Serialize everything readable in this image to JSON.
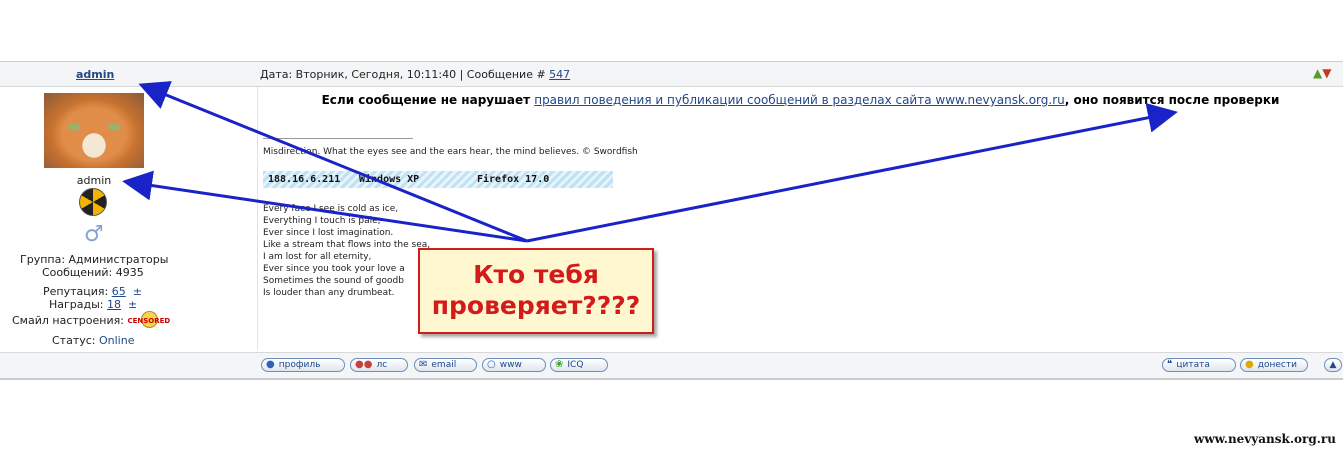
{
  "header": {
    "author": "admin",
    "date_prefix": "Дата: Вторник, Сегодня, 10:11:40 | Сообщение # ",
    "post_number": "547",
    "vote_up_icon": "thumbs-up-icon",
    "vote_down_icon": "thumbs-down-icon"
  },
  "profile": {
    "username": "admin",
    "group": "Группа: Администраторы",
    "messages": "Сообщений: 4935",
    "reputation_label": "Репутация: ",
    "reputation_value": "65",
    "awards_label": "Награды: ",
    "awards_value": "18",
    "pm_symbol": "±",
    "mood_label": "Смайл настроения:",
    "mood_icon_text": "CENSORED",
    "status_label": "Статус: ",
    "status_value": "Online",
    "gender_symbol": "♂"
  },
  "post": {
    "notice_before": "Если сообщение не нарушает ",
    "notice_link": "правил поведения и публикации сообщений в разделах сайта www.nevyansk.org.ru",
    "notice_after": ", оно появится после проверки",
    "signature_quote": "Misdirection. What the eyes see and the ears hear, the mind believes. © Swordfish",
    "ua_ip": "188.16.6.211",
    "ua_os": "Windows XP",
    "ua_browser": "Firefox 17.0",
    "poem": [
      "Every face I see is cold as ice,",
      "Everything I touch is pale,",
      "Ever since I lost imagination.",
      "Like a stream that flows into the sea,",
      "I am lost for all eternity,",
      "Ever since you took your love a",
      "Sometimes the sound of goodb",
      "Is louder than any drumbeat."
    ]
  },
  "buttons": {
    "profile": "профиль",
    "pm": "лс",
    "email": "email",
    "www": "www",
    "icq": "ICQ",
    "quote": "цитата",
    "report": "донести"
  },
  "annotation": {
    "line1": "Кто тебя",
    "line2": "проверяет????",
    "color": "#d21b1b",
    "arrow_color": "#1a23c8"
  },
  "watermark": "www.nevyansk.org.ru"
}
